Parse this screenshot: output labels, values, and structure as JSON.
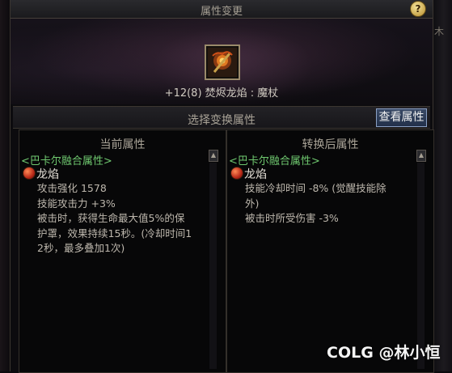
{
  "window": {
    "title": "属性变更",
    "help_label": "?"
  },
  "item": {
    "name": "+12(8) 焚烬龙焰 : 魔杖",
    "icon": "flame-staff-icon"
  },
  "section": {
    "title": "选择变换属性",
    "view_button": "查看属性"
  },
  "left_panel": {
    "header": "当前属性",
    "group": "<巴卡尔融合属性>",
    "attr_name": "龙焰",
    "lines": [
      "攻击强化 1578",
      "技能攻击力 +3%",
      "被击时，获得生命最大值5%的保",
      "护罩，效果持续15秒。(冷却时间1",
      "2秒，最多叠加1次)"
    ]
  },
  "right_panel": {
    "header": "转换后属性",
    "group": "<巴卡尔融合属性>",
    "attr_name": "龙焰",
    "lines": [
      "技能冷却时间 -8% (觉醒技能除",
      "外)",
      "被击时所受伤害 -3%"
    ]
  },
  "scroll_up_label": "▲",
  "edge_glyph": "木",
  "watermark": {
    "brand": "COLG",
    "user": "@林小恒"
  },
  "colors": {
    "group_green": "#6fc86f",
    "button_blue": "#3a4a66",
    "item_frame": "#9a8a6a"
  }
}
